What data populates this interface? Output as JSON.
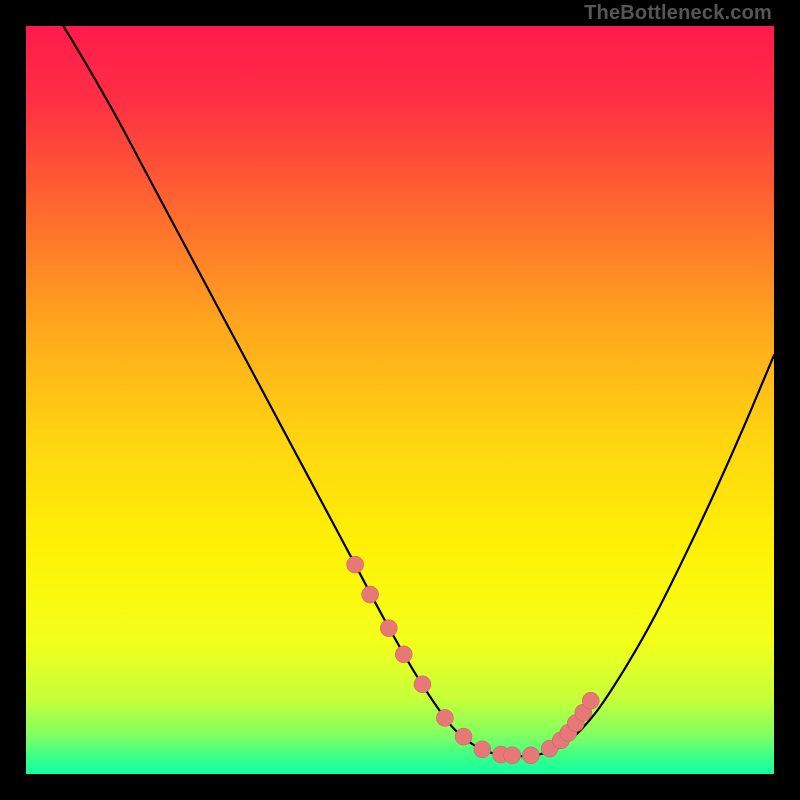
{
  "watermark": "TheBottleneck.com",
  "colors": {
    "frame": "#000000",
    "gradient_stops": [
      {
        "offset": 0.0,
        "color": "#ff1a4b"
      },
      {
        "offset": 0.1,
        "color": "#ff2f44"
      },
      {
        "offset": 0.25,
        "color": "#ff6a2e"
      },
      {
        "offset": 0.4,
        "color": "#ffa61e"
      },
      {
        "offset": 0.55,
        "color": "#ffd411"
      },
      {
        "offset": 0.7,
        "color": "#fff205"
      },
      {
        "offset": 0.82,
        "color": "#f4ff1a"
      },
      {
        "offset": 0.9,
        "color": "#c6ff3a"
      },
      {
        "offset": 0.95,
        "color": "#7dff63"
      },
      {
        "offset": 0.975,
        "color": "#3fff88"
      },
      {
        "offset": 1.0,
        "color": "#10ffa0"
      }
    ],
    "curve": "#000000",
    "marker_fill": "#e77878",
    "marker_stroke": "#cf5a5a"
  },
  "chart_data": {
    "type": "line",
    "title": "",
    "xlabel": "",
    "ylabel": "",
    "xlim": [
      0,
      100
    ],
    "ylim": [
      0,
      100
    ],
    "grid": false,
    "legend": false,
    "series": [
      {
        "name": "bottleneck-curve",
        "x": [
          5,
          8,
          12,
          16,
          20,
          24,
          28,
          32,
          36,
          40,
          44,
          48,
          52,
          56,
          58,
          60,
          62,
          64,
          68,
          72,
          76,
          80,
          84,
          88,
          92,
          96,
          100
        ],
        "y": [
          100,
          95,
          88,
          80.5,
          73,
          65.5,
          58,
          50.5,
          43,
          35.5,
          28,
          20.5,
          13.5,
          7.5,
          5.3,
          3.8,
          2.9,
          2.5,
          2.5,
          4.0,
          8.0,
          14.0,
          21.0,
          29.0,
          37.5,
          46.5,
          56.0
        ]
      }
    ],
    "markers": {
      "name": "highlighted-points",
      "x": [
        44.0,
        46.0,
        48.5,
        50.5,
        53.0,
        56.0,
        58.5,
        61.0,
        63.5,
        65.0,
        67.5,
        70.0,
        71.5,
        72.5,
        73.5,
        74.5,
        75.5
      ],
      "y": [
        28.0,
        24.0,
        19.5,
        16.0,
        12.0,
        7.5,
        5.0,
        3.3,
        2.6,
        2.5,
        2.5,
        3.4,
        4.5,
        5.5,
        6.8,
        8.2,
        9.8
      ]
    },
    "ticks": {
      "name": "right-branch-ticks",
      "x": [
        69.5,
        70.3,
        71.0,
        71.7,
        72.4,
        73.1,
        73.8,
        74.5,
        75.2
      ],
      "y": [
        3.0,
        3.5,
        4.2,
        4.9,
        5.6,
        6.4,
        7.3,
        8.2,
        9.2
      ]
    }
  }
}
